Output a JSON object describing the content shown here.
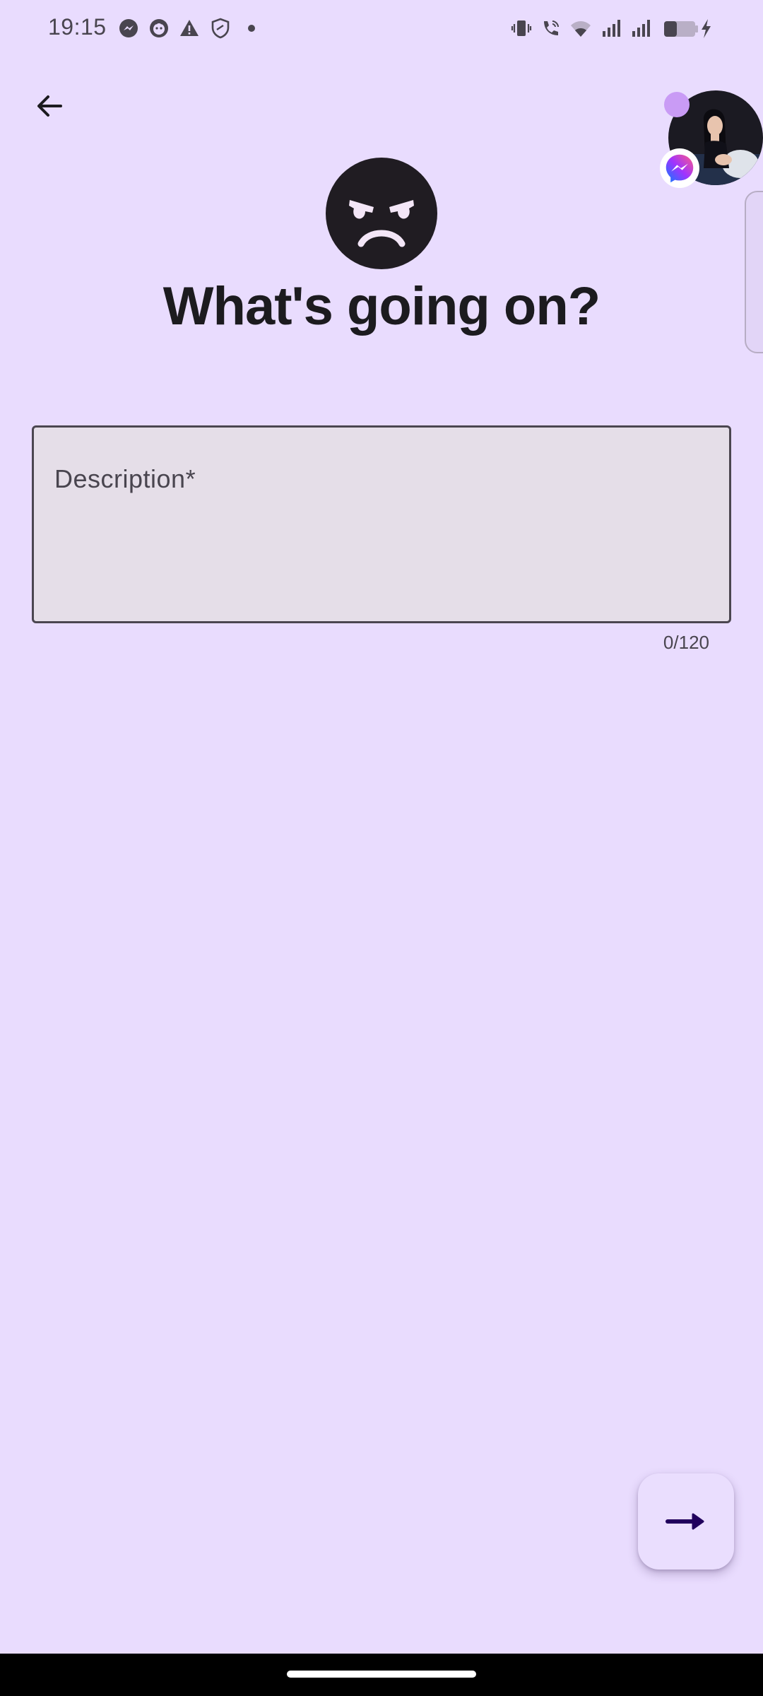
{
  "status_bar": {
    "time": "19:15",
    "left_icons": [
      "messenger-icon",
      "cat-app-icon",
      "warning-icon",
      "shield-icon",
      "dot-icon"
    ],
    "right_icons": [
      "vibrate-icon",
      "wifi-call-icon",
      "wifi-icon",
      "signal-icon",
      "signal-icon",
      "battery-charging-icon"
    ]
  },
  "header": {
    "back_icon": "arrow-left-icon"
  },
  "chat_head": {
    "badge_icon": "messenger-icon",
    "unread_indicator_color": "#c99bf5"
  },
  "mood": {
    "icon": "angry-face-icon",
    "title": "What's going on?"
  },
  "description": {
    "placeholder": "Description*",
    "value": "",
    "counter": "0/120"
  },
  "fab": {
    "icon": "arrow-right-icon"
  },
  "colors": {
    "background": "#e9dcfe",
    "text_primary": "#1c1b1f",
    "text_secondary": "#49454f",
    "field_background": "#e5dee8",
    "fab_icon": "#21005d"
  }
}
